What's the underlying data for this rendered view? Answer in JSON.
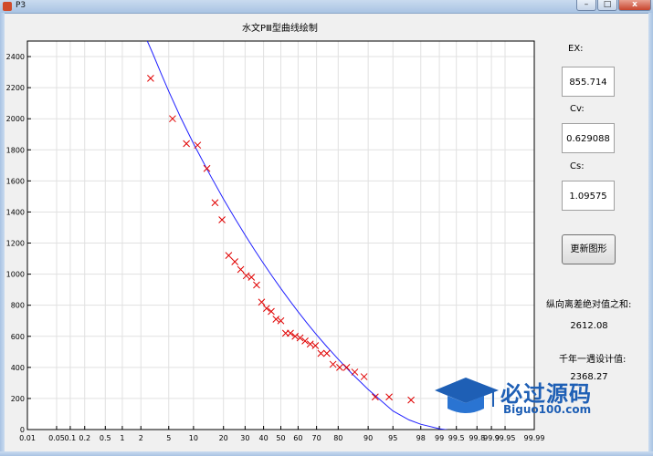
{
  "window": {
    "title": "P3",
    "minimize": "–",
    "maximize": "□",
    "close": "x"
  },
  "plot": {
    "title": "水文PⅢ型曲线绘制"
  },
  "chart_data": {
    "type": "scatter",
    "title": "水文PⅢ型曲线绘制",
    "xscale": "probability",
    "xticks": [
      "0.01",
      "0.05",
      "0.1",
      "0.2",
      "0.5",
      "1",
      "2",
      "5",
      "10",
      "20",
      "30",
      "40",
      "50",
      "60",
      "70",
      "80",
      "90",
      "95",
      "98",
      "99",
      "99.5",
      "99.8",
      "99.9",
      "99.95",
      "99.99"
    ],
    "yticks": [
      0,
      200,
      400,
      600,
      800,
      1000,
      1200,
      1400,
      1600,
      1800,
      2000,
      2200,
      2400
    ],
    "ylim": [
      0,
      2500
    ],
    "grid": true,
    "series": [
      {
        "kind": "markers",
        "color": "#e00000",
        "x": [
          2.8,
          5.6,
          8.3,
          11.1,
          13.9,
          16.7,
          19.4,
          22.2,
          25.0,
          27.8,
          30.6,
          33.3,
          36.1,
          38.9,
          41.7,
          44.4,
          47.2,
          50.0,
          52.8,
          55.6,
          58.3,
          61.1,
          63.9,
          66.7,
          69.4,
          72.2,
          75.0,
          77.8,
          80.6,
          83.3,
          86.1,
          88.9,
          91.7,
          94.4,
          97.2
        ],
        "y": [
          2260,
          2000,
          1840,
          1830,
          1680,
          1460,
          1350,
          1120,
          1080,
          1030,
          990,
          980,
          930,
          820,
          780,
          760,
          710,
          700,
          620,
          620,
          600,
          590,
          570,
          550,
          540,
          490,
          490,
          420,
          400,
          400,
          370,
          340,
          210,
          210,
          190
        ]
      },
      {
        "kind": "line",
        "color": "#2020ff",
        "x": [
          2.5,
          3,
          4,
          5,
          7,
          10,
          15,
          20,
          25,
          30,
          35,
          40,
          45,
          50,
          55,
          60,
          65,
          70,
          75,
          80,
          85,
          90,
          95,
          97,
          98,
          99,
          99.5
        ],
        "y": [
          2500,
          2421,
          2284,
          2176,
          2013,
          1840,
          1636,
          1483,
          1359,
          1252,
          1156,
          1068,
          986,
          908,
          832,
          758,
          684,
          610,
          534,
          453,
          363,
          258,
          120,
          62,
          34,
          5,
          -10
        ]
      }
    ]
  },
  "panel": {
    "ex_label": "EX:",
    "ex_value": "855.714",
    "cv_label": "Cv:",
    "cv_value": "0.629088",
    "cs_label": "Cs:",
    "cs_value": "1.09575",
    "refresh_button": "更新图形",
    "deviation_label": "纵向离差绝对值之和:",
    "deviation_value": "2612.08",
    "millennium_label": "千年一遇设计值:",
    "millennium_value": "2368.27"
  },
  "watermark": {
    "text": "必过源码",
    "url": "Biguo100.com"
  }
}
